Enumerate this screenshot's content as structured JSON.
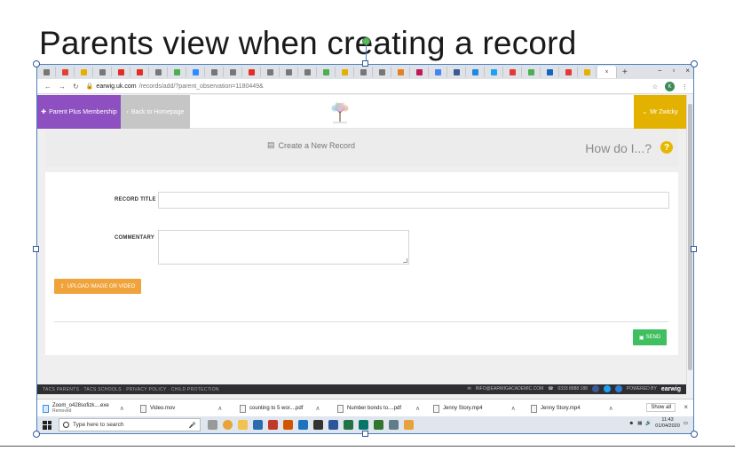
{
  "slide": {
    "title": "Parents view when creating a record"
  },
  "browser": {
    "tab_close": "×",
    "new_tab": "+",
    "window_controls": [
      "−",
      "▫",
      "×"
    ],
    "url_host": "earwig.uk.com",
    "url_path": "/records/add/?parent_observation=1180449&",
    "profile_initial": "K"
  },
  "site": {
    "parent_plus_label": "Parent Plus Membership",
    "back_label": "Back to Homepage",
    "user_label": "Mr Zwicky",
    "create_title": "Create a New Record",
    "how_do_i": "How do I...?",
    "help_glyph": "?",
    "record_title_label": "RECORD TITLE",
    "commentary_label": "COMMENTARY",
    "upload_label": "UPLOAD IMAGE OR VIDEO",
    "send_label": "SEND"
  },
  "footer": {
    "links": "TACS PARENTS · TACS SCHOOLS · PRIVACY POLICY · CHILD PROTECTION",
    "email": "INFO@EARWIGACADEMIC.COM",
    "phone": "0333 8888 188",
    "powered": "POWERED BY",
    "brand": "earwig"
  },
  "downloads": {
    "items": [
      {
        "name": "Zoom_o428sofizk....exe",
        "sub": "Removed"
      },
      {
        "name": "Video.mov",
        "sub": ""
      },
      {
        "name": "counting to 5 wor....pdf",
        "sub": ""
      },
      {
        "name": "Number bonds to....pdf",
        "sub": ""
      },
      {
        "name": "Jenny Story.mp4",
        "sub": ""
      },
      {
        "name": "Jenny Story.mp4",
        "sub": ""
      }
    ],
    "chevron": "∧",
    "show_all": "Show all",
    "close": "×"
  },
  "taskbar": {
    "search_placeholder": "Type here to search",
    "time": "11:43",
    "date": "01/04/2020"
  },
  "colors": {
    "purple": "#8e4fc1",
    "yellow": "#e3b200",
    "orange": "#f0a33a",
    "green": "#3fbf5f"
  }
}
